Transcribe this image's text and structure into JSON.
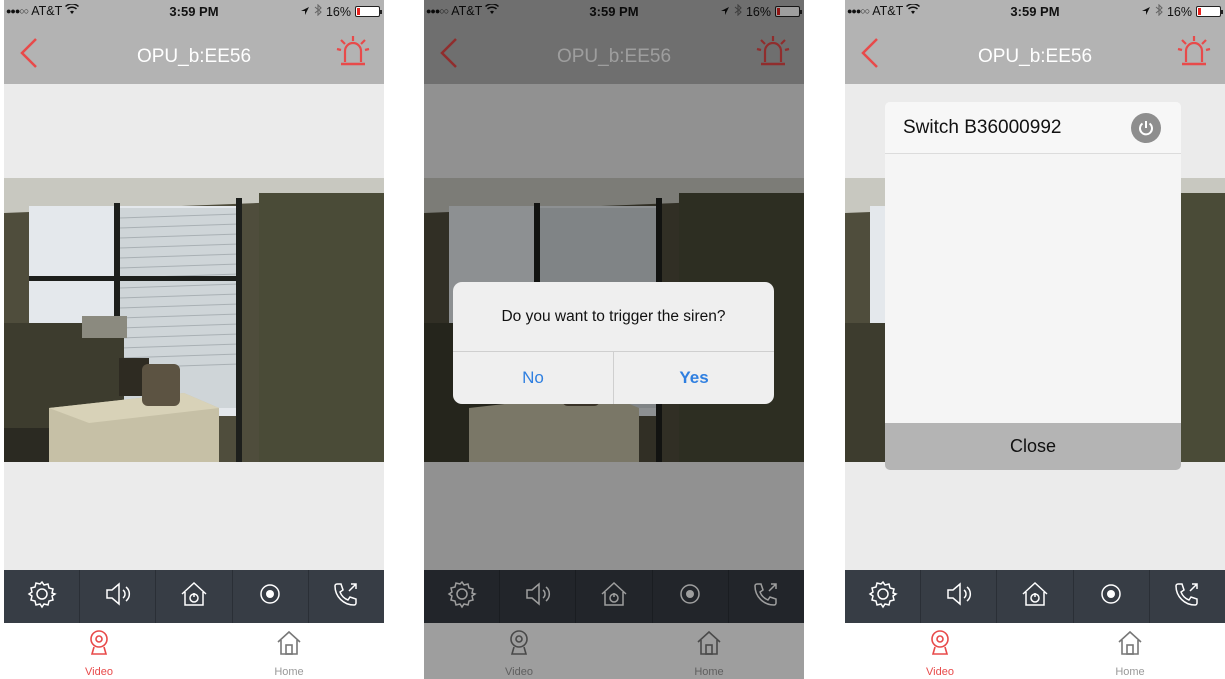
{
  "status_bar": {
    "carrier": "AT&T",
    "time": "3:59 PM",
    "battery": "16%",
    "battery_level": 0.16
  },
  "nav": {
    "title": "OPU_b:EE56"
  },
  "toolbar": {
    "icons": [
      "settings-icon",
      "speaker-icon",
      "home-arm-icon",
      "record-icon",
      "call-icon"
    ]
  },
  "tabbar": {
    "video_label": "Video",
    "home_label": "Home"
  },
  "alert": {
    "message": "Do you want to trigger the siren?",
    "no_label": "No",
    "yes_label": "Yes"
  },
  "switch_popup": {
    "item_label": "Switch B36000992",
    "close_label": "Close"
  },
  "colors": {
    "accent": "#e84a4a",
    "toolbar_bg": "#373d45",
    "navbar_bg": "#b3b3b3",
    "alert_button": "#2f7fe0"
  }
}
